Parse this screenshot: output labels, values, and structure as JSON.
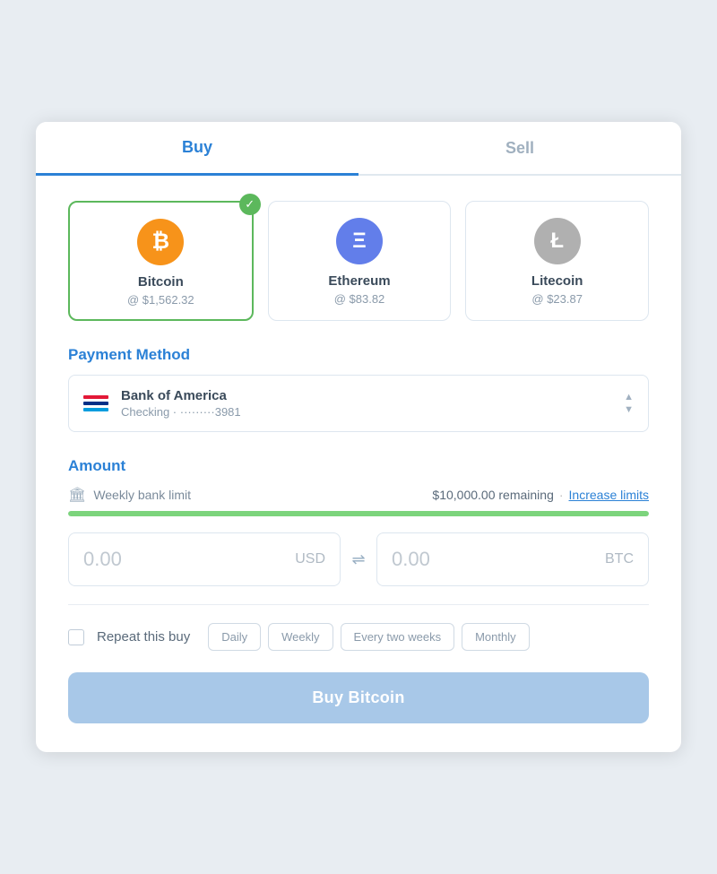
{
  "tabs": [
    {
      "label": "Buy",
      "active": true
    },
    {
      "label": "Sell",
      "active": false
    }
  ],
  "cryptos": [
    {
      "id": "btc",
      "name": "Bitcoin",
      "price": "@ $1,562.32",
      "selected": true,
      "symbol": "₿",
      "class": "btc"
    },
    {
      "id": "eth",
      "name": "Ethereum",
      "price": "@ $83.82",
      "selected": false,
      "symbol": "Ξ",
      "class": "eth"
    },
    {
      "id": "ltc",
      "name": "Litecoin",
      "price": "@ $23.87",
      "selected": false,
      "symbol": "Ł",
      "class": "ltc"
    }
  ],
  "payment_method": {
    "section_title": "Payment Method",
    "bank_name": "Bank of America",
    "bank_detail": "Checking · ·········3981"
  },
  "amount": {
    "section_title": "Amount",
    "limit_label": "Weekly bank limit",
    "limit_remaining": "$10,000.00 remaining",
    "limit_separator": "·",
    "increase_link": "Increase limits",
    "progress_pct": 100,
    "usd_value": "0.00",
    "usd_currency": "USD",
    "btc_value": "0.00",
    "btc_currency": "BTC",
    "swap_symbol": "⇌"
  },
  "repeat": {
    "label": "Repeat this buy",
    "frequencies": [
      "Daily",
      "Weekly",
      "Every two weeks",
      "Monthly"
    ]
  },
  "buy_button_label": "Buy Bitcoin"
}
